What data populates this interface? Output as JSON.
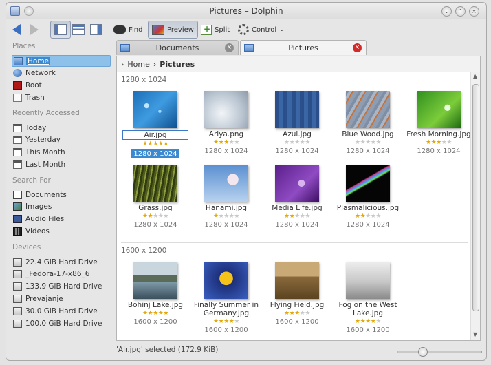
{
  "window": {
    "title": "Pictures – Dolphin"
  },
  "toolbar": {
    "find": "Find",
    "preview": "Preview",
    "split": "Split",
    "control": "Control"
  },
  "places": {
    "places_header": "Places",
    "places_items": [
      {
        "label": "Home",
        "icon": "home-folder-icon"
      },
      {
        "label": "Network",
        "icon": "network-icon"
      },
      {
        "label": "Root",
        "icon": "root-folder-icon"
      },
      {
        "label": "Trash",
        "icon": "trash-icon"
      }
    ],
    "recent_header": "Recently Accessed",
    "recent_items": [
      {
        "label": "Today",
        "icon": "calendar-icon"
      },
      {
        "label": "Yesterday",
        "icon": "calendar-icon"
      },
      {
        "label": "This Month",
        "icon": "calendar-icon"
      },
      {
        "label": "Last Month",
        "icon": "calendar-icon"
      }
    ],
    "search_header": "Search For",
    "search_items": [
      {
        "label": "Documents",
        "icon": "documents-icon"
      },
      {
        "label": "Images",
        "icon": "images-icon"
      },
      {
        "label": "Audio Files",
        "icon": "audio-icon"
      },
      {
        "label": "Videos",
        "icon": "video-icon"
      }
    ],
    "devices_header": "Devices",
    "devices_items": [
      {
        "label": "22.4 GiB Hard Drive",
        "icon": "hard-drive-icon"
      },
      {
        "label": "_Fedora-17-x86_6",
        "icon": "hard-drive-icon"
      },
      {
        "label": "133.9 GiB Hard Drive",
        "icon": "hard-drive-icon"
      },
      {
        "label": "Prevajanje",
        "icon": "hard-drive-icon"
      },
      {
        "label": "30.0 GiB Hard Drive",
        "icon": "hard-drive-icon"
      },
      {
        "label": "100.0 GiB Hard Drive",
        "icon": "hard-drive-icon"
      }
    ]
  },
  "tabs": [
    {
      "label": "Documents",
      "active": false
    },
    {
      "label": "Pictures",
      "active": true
    }
  ],
  "breadcrumb": {
    "root": "Home",
    "current": "Pictures"
  },
  "groups": [
    {
      "header": "1280 x 1024",
      "items": [
        {
          "name": "Air.jpg",
          "rating": 5,
          "dims": "1280 x 1024",
          "selected": true
        },
        {
          "name": "Ariya.png",
          "rating": 3,
          "dims": "1280 x 1024"
        },
        {
          "name": "Azul.jpg",
          "rating": 0,
          "dims": "1280 x 1024"
        },
        {
          "name": "Blue Wood.jpg",
          "rating": 0,
          "dims": "1280 x 1024"
        },
        {
          "name": "Fresh Morning.jpg",
          "rating": 3,
          "dims": "1280 x 1024"
        },
        {
          "name": "Grass.jpg",
          "rating": 2,
          "dims": "1280 x 1024"
        },
        {
          "name": "Hanami.jpg",
          "rating": 1,
          "dims": "1280 x 1024"
        },
        {
          "name": "Media Life.jpg",
          "rating": 2,
          "dims": "1280 x 1024"
        },
        {
          "name": "Plasmalicious.jpg",
          "rating": 2,
          "dims": "1280 x 1024"
        }
      ]
    },
    {
      "header": "1600 x 1200",
      "items": [
        {
          "name": "Bohinj Lake.jpg",
          "rating": 5,
          "dims": "1600 x 1200"
        },
        {
          "name": "Finally Summer in Germany.jpg",
          "rating": 4,
          "dims": "1600 x 1200"
        },
        {
          "name": "Flying Field.jpg",
          "rating": 3,
          "dims": "1600 x 1200"
        },
        {
          "name": "Fog on the West Lake.jpg",
          "rating": 4,
          "dims": "1600 x 1200"
        }
      ]
    }
  ],
  "status": {
    "text": "'Air.jpg' selected (172.9 KiB)"
  },
  "zoom": {
    "level": 0.27
  },
  "colors": {
    "selection": "#3b89d0",
    "star": "#e3a80a",
    "accent": "#4f84c8"
  }
}
